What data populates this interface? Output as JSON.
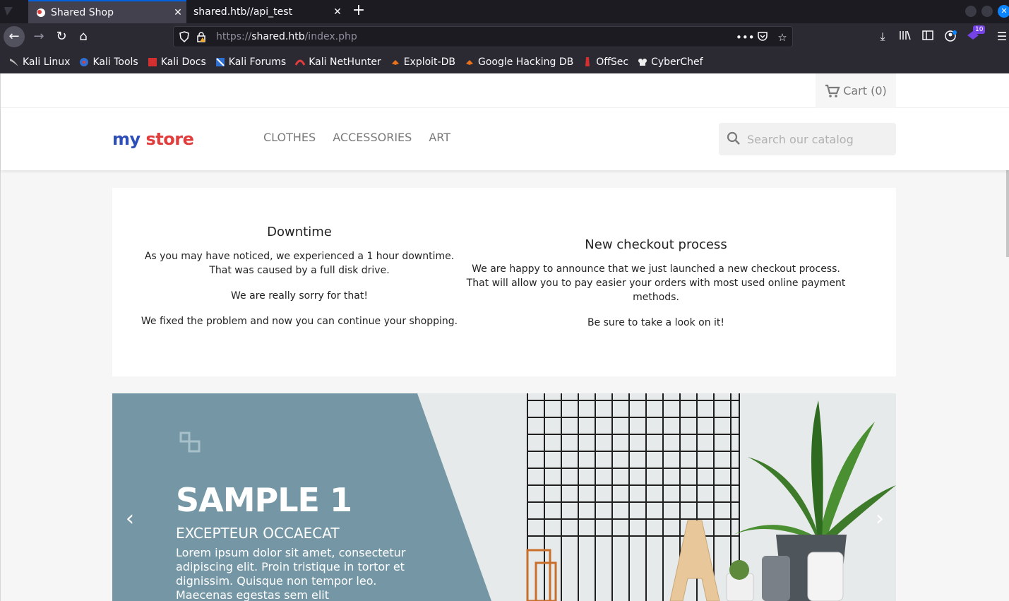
{
  "browser": {
    "tabs": [
      {
        "title": "Shared Shop",
        "active": true
      },
      {
        "title": "shared.htb//api_test",
        "active": false
      }
    ],
    "url": {
      "prefix": "https://",
      "domain": "shared.htb",
      "path": "/index.php"
    },
    "bookmarks": [
      "Kali Linux",
      "Kali Tools",
      "Kali Docs",
      "Kali Forums",
      "Kali NetHunter",
      "Exploit-DB",
      "Google Hacking DB",
      "OffSec",
      "CyberChef"
    ],
    "extension_badge": "10"
  },
  "header": {
    "cart_label": "Cart",
    "cart_count": "(0)",
    "logo_part1": "my",
    "logo_part2": "store",
    "menu": [
      "CLOTHES",
      "ACCESSORIES",
      "ART"
    ],
    "search_placeholder": "Search our catalog"
  },
  "news": {
    "left": {
      "title": "Downtime",
      "line1": "As you may have noticed, we experienced a 1 hour downtime.",
      "line2": "That was caused by a full disk drive.",
      "line3": "We are really sorry for that!",
      "line4": "We fixed the problem and now you can continue your shopping."
    },
    "right": {
      "title": "New checkout process",
      "line1": "We are happy to announce that we just launched a new checkout process.",
      "line2": "That will allow you to pay easier your orders with most used online payment methods.",
      "line3": "Be sure to take a look on it!"
    }
  },
  "slider": {
    "title": "SAMPLE 1",
    "subtitle": "EXCEPTEUR OCCAECAT",
    "body_lines": [
      "Lorem ipsum dolor sit amet, consectetur",
      "adipiscing elit. Proin tristique in tortor et",
      "dignissim. Quisque non tempor leo.",
      "Maecenas egestas sem elit"
    ],
    "panel_color": "#7597a5"
  },
  "colors": {
    "accent": "#0061e0",
    "logo_blue": "#2e4fb8",
    "logo_red": "#e23d3d"
  }
}
